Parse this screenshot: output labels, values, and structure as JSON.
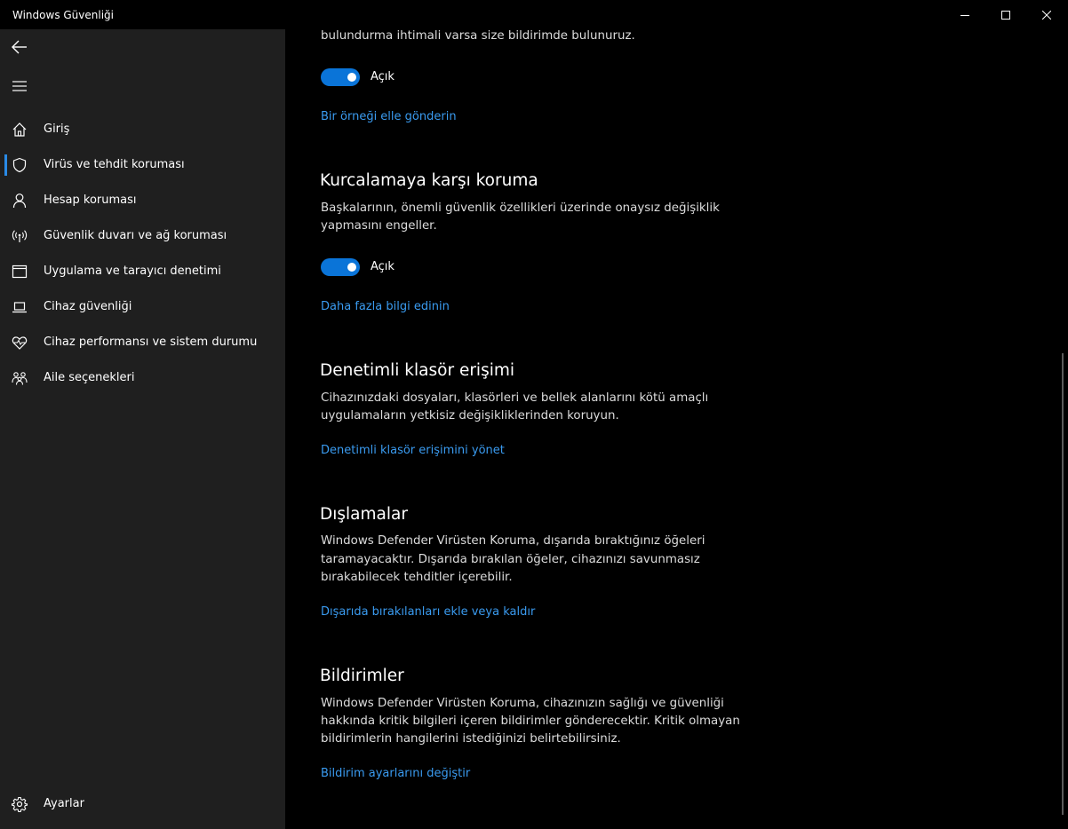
{
  "window": {
    "title": "Windows Güvenliği"
  },
  "sidebar": {
    "items": [
      {
        "label": "Giriş",
        "icon": "home-icon"
      },
      {
        "label": "Virüs ve tehdit koruması",
        "icon": "shield-icon"
      },
      {
        "label": "Hesap koruması",
        "icon": "person-icon"
      },
      {
        "label": "Güvenlik duvarı ve ağ koruması",
        "icon": "antenna-icon"
      },
      {
        "label": "Uygulama ve tarayıcı denetimi",
        "icon": "browser-window-icon"
      },
      {
        "label": "Cihaz güvenliği",
        "icon": "laptop-icon"
      },
      {
        "label": "Cihaz performansı ve sistem durumu",
        "icon": "heart-pulse-icon"
      },
      {
        "label": "Aile seçenekleri",
        "icon": "family-icon"
      }
    ],
    "active_index": 1,
    "settings_label": "Ayarlar"
  },
  "content": {
    "top_text": "bulundurma ihtimali varsa size bildirimde bulunuruz.",
    "sample_toggle_label": "Açık",
    "sample_link": "Bir örneği elle gönderin",
    "tamper": {
      "title": "Kurcalamaya karşı koruma",
      "desc_line1": "Başkalarının, önemli güvenlik özellikleri üzerinde onaysız değişiklik",
      "desc_line2": "yapmasını engeller.",
      "toggle_label": "Açık",
      "link": "Daha fazla bilgi edinin"
    },
    "folder": {
      "title": "Denetimli klasör erişimi",
      "desc_line1": "Cihazınızdaki dosyaları, klasörleri ve bellek alanlarını kötü amaçlı",
      "desc_line2": "uygulamaların yetkisiz değişikliklerinden koruyun.",
      "link": "Denetimli klasör erişimini yönet"
    },
    "exclusions": {
      "title": "Dışlamalar",
      "desc_line1": "Windows Defender Virüsten Koruma, dışarıda bıraktığınız öğeleri",
      "desc_line2": "taramayacaktır. Dışarıda bırakılan öğeler, cihazınızı savunmasız",
      "desc_line3": "bırakabilecek tehditler içerebilir.",
      "link": "Dışarıda bırakılanları ekle veya kaldır"
    },
    "notifications": {
      "title": "Bildirimler",
      "desc_line1": "Windows Defender Virüsten Koruma, cihazınızın sağlığı ve güvenliği",
      "desc_line2": "hakkında kritik bilgileri içeren bildirimler gönderecektir. Kritik olmayan",
      "desc_line3": "bildirimlerin hangilerini istediğinizi belirtebilirsiniz.",
      "link": "Bildirim ayarlarını değiştir"
    }
  },
  "colors": {
    "accent": "#0a74d8",
    "link": "#3a9bf0",
    "sidebar_bg": "#1f1f1f",
    "content_bg": "#000000"
  }
}
